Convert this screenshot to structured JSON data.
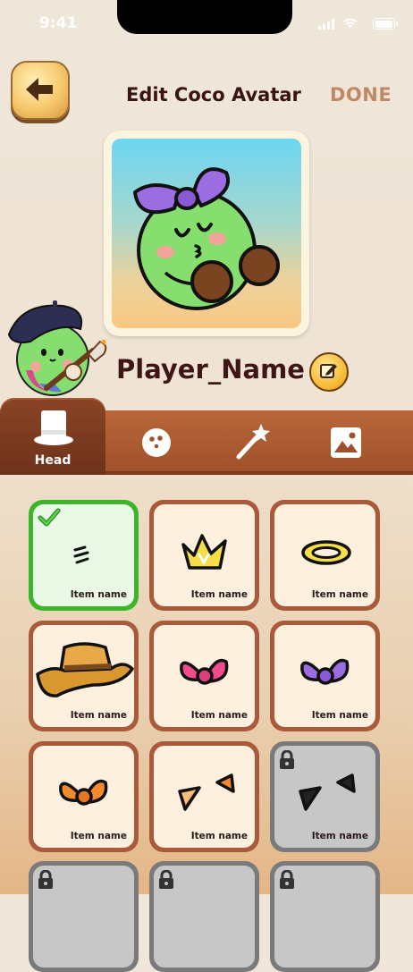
{
  "status_bar": {
    "time": "9:41"
  },
  "header": {
    "title": "Edit Coco Avatar",
    "done_label": "DONE"
  },
  "player": {
    "name": "Player_Name"
  },
  "tabs": [
    {
      "label": "Head",
      "icon": "top-hat-icon",
      "active": true
    },
    {
      "label": "",
      "icon": "face-icon",
      "active": false
    },
    {
      "label": "",
      "icon": "magic-wand-icon",
      "active": false
    },
    {
      "label": "",
      "icon": "image-icon",
      "active": false
    }
  ],
  "items": [
    {
      "name": "Item name",
      "art": "whiskers",
      "selected": true,
      "locked": false
    },
    {
      "name": "Item name",
      "art": "crown",
      "selected": false,
      "locked": false
    },
    {
      "name": "Item name",
      "art": "halo",
      "selected": false,
      "locked": false
    },
    {
      "name": "Item name",
      "art": "cowboy-hat",
      "selected": false,
      "locked": false
    },
    {
      "name": "Item name",
      "art": "pink-bow",
      "selected": false,
      "locked": false
    },
    {
      "name": "Item name",
      "art": "purple-bow",
      "selected": false,
      "locked": false
    },
    {
      "name": "Item name",
      "art": "orange-bow",
      "selected": false,
      "locked": false
    },
    {
      "name": "Item name",
      "art": "orange-ears",
      "selected": false,
      "locked": false
    },
    {
      "name": "Item name",
      "art": "black-ears",
      "selected": false,
      "locked": true
    },
    {
      "name": "",
      "art": "",
      "selected": false,
      "locked": true
    },
    {
      "name": "",
      "art": "",
      "selected": false,
      "locked": true
    },
    {
      "name": "",
      "art": "",
      "selected": false,
      "locked": true
    }
  ],
  "colors": {
    "accent_green": "#3cb52a",
    "card_brown": "#a95a3b",
    "tab_brown": "#a0512b",
    "title_text": "#3a1414",
    "done_text": "#c08966"
  }
}
